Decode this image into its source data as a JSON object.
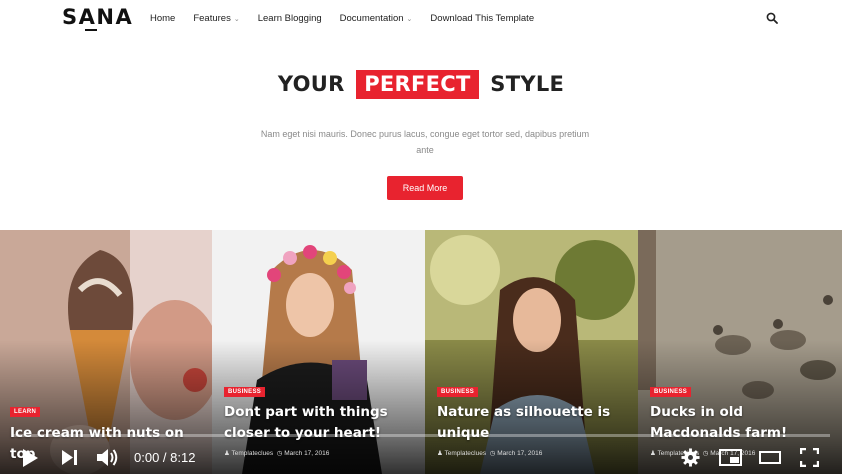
{
  "header": {
    "logo": "SANA",
    "nav": [
      {
        "label": "Home",
        "has_dropdown": false
      },
      {
        "label": "Features",
        "has_dropdown": true
      },
      {
        "label": "Learn Blogging",
        "has_dropdown": false
      },
      {
        "label": "Documentation",
        "has_dropdown": true
      },
      {
        "label": "Download This Template",
        "has_dropdown": false
      }
    ],
    "search_icon": "search-icon"
  },
  "hero": {
    "title_pre": "YOUR",
    "title_highlight": "PERFECT",
    "title_post": "STYLE",
    "subtitle": "Nam eget nisi mauris. Donec purus lacus, congue eget tortor sed, dapibus pretium ante",
    "button_label": "Read More"
  },
  "cards": [
    {
      "badge": "Learn",
      "title": "Ice cream with nuts on top",
      "author": "",
      "date": ""
    },
    {
      "badge": "Business",
      "title": "Dont part with things closer to your heart!",
      "author": "Templateclues",
      "date": "March 17, 2016"
    },
    {
      "badge": "Business",
      "title": "Nature as silhouette is unique",
      "author": "Templateclues",
      "date": "March 17, 2016"
    },
    {
      "badge": "Business",
      "title": "Ducks in old Macdonalds farm!",
      "author": "Templateclues",
      "date": "March 17, 2016"
    }
  ],
  "player": {
    "time": "0:00 / 8:12",
    "progress": 0
  },
  "colors": {
    "accent": "#e8232f",
    "text": "#222222",
    "muted": "#8a8a8a"
  }
}
